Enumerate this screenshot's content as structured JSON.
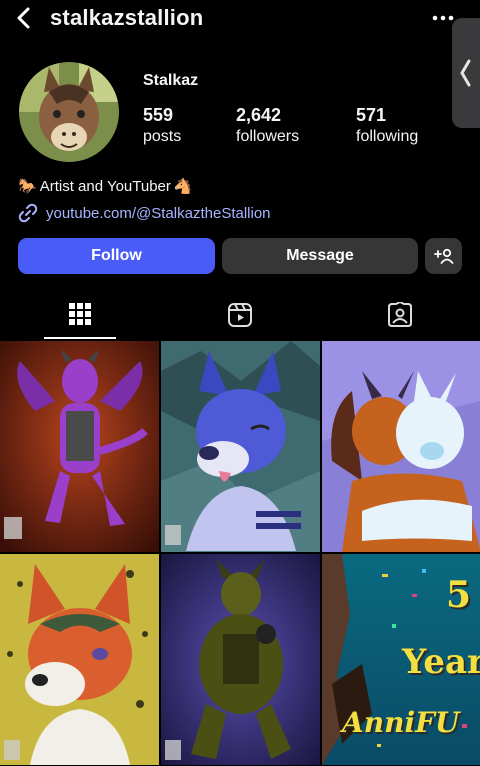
{
  "header": {
    "username": "stalkazstallion"
  },
  "profile": {
    "display_name": "Stalkaz",
    "stats": [
      {
        "value": "559",
        "label": "posts"
      },
      {
        "value": "2,642",
        "label": "followers"
      },
      {
        "value": "571",
        "label": "following"
      }
    ],
    "bio": {
      "text": "Artist and YouTuber",
      "emoji_left": "🐎",
      "emoji_right": "🐴"
    },
    "link": "youtube.com/@StalkaztheStallion"
  },
  "actions": {
    "follow": "Follow",
    "message": "Message"
  },
  "tabs": [
    "grid-icon",
    "reels-icon",
    "tagged-icon"
  ],
  "colors": {
    "accent": "#4a5cf7",
    "link": "#a9b4ff",
    "secondary_button": "#363636"
  },
  "posts": {
    "last_card_text": {
      "number": "5",
      "word": "Year",
      "title": "AnniFU"
    }
  }
}
